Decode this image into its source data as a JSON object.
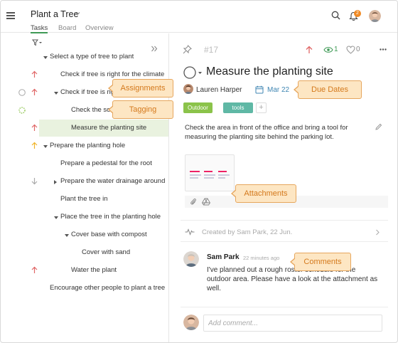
{
  "header": {
    "project_title": "Plant a Tree",
    "tabs": [
      {
        "label": "Tasks",
        "active": true
      },
      {
        "label": "Board",
        "active": false
      },
      {
        "label": "Overview",
        "active": false
      }
    ],
    "notification_count": "2"
  },
  "task_list": [
    {
      "title": "Select a type of tree to plant",
      "priority": "none",
      "expand": "expanded"
    },
    {
      "title": "Check if tree is right for the climate",
      "priority": "high",
      "expand": "none"
    },
    {
      "title": "Check if tree is right for the soil",
      "priority": "high",
      "expand": "expanded"
    },
    {
      "title": "Check the soil",
      "priority": "none",
      "expand": "none"
    },
    {
      "title": "Measure the planting site",
      "priority": "high",
      "expand": "none",
      "selected": true
    },
    {
      "title": "Prepare the planting hole",
      "priority": "medium",
      "expand": "expanded"
    },
    {
      "title": "Prepare a pedestal for the root",
      "priority": "none",
      "expand": "none"
    },
    {
      "title": "Prepare the water drainage around",
      "priority": "low",
      "expand": "collapsed"
    },
    {
      "title": "Plant the tree in",
      "priority": "none",
      "expand": "none"
    },
    {
      "title": "Place the tree in the planting hole",
      "priority": "none",
      "expand": "expanded"
    },
    {
      "title": "Cover base with compost",
      "priority": "none",
      "expand": "expanded"
    },
    {
      "title": "Cover with sand",
      "priority": "none",
      "expand": "none"
    },
    {
      "title": "Water the plant",
      "priority": "high",
      "expand": "none"
    },
    {
      "title": "Encourage other people to plant a tree",
      "priority": "none",
      "expand": "none"
    }
  ],
  "task_detail": {
    "number": "#17",
    "followers_count": "1",
    "likes_count": "0",
    "title": "Measure the planting site",
    "assignee": "Lauren Harper",
    "due_date": "Mar 22",
    "tags": [
      {
        "label": "Outdoor",
        "color": "#8bc34a"
      },
      {
        "label": "tools",
        "color": "#5fb8a5"
      }
    ],
    "description": "Check the area in front of the office and bring a tool for measuring the planting site behind the parking lot.",
    "activity": "Created by Sam Park, 22 Jun.",
    "comment": {
      "author": "Sam Park",
      "time": "22 minutes ago",
      "text": "I've planned out a rough roster schedule for the outdoor area. Please have a look at the attachment as well."
    },
    "comment_placeholder": "Add comment..."
  },
  "callouts": {
    "assignments": "Assignments",
    "tagging": "Tagging",
    "due_dates": "Due Dates",
    "attachments": "Attachments",
    "comments": "Comments"
  },
  "colors": {
    "accent_green": "#3f9a56",
    "priority_high": "#e06666",
    "priority_medium": "#f0b429",
    "priority_low": "#aaaaaa",
    "link_blue": "#3f86b3",
    "callout_bg": "#fde6c3",
    "callout_text": "#d4791c"
  }
}
